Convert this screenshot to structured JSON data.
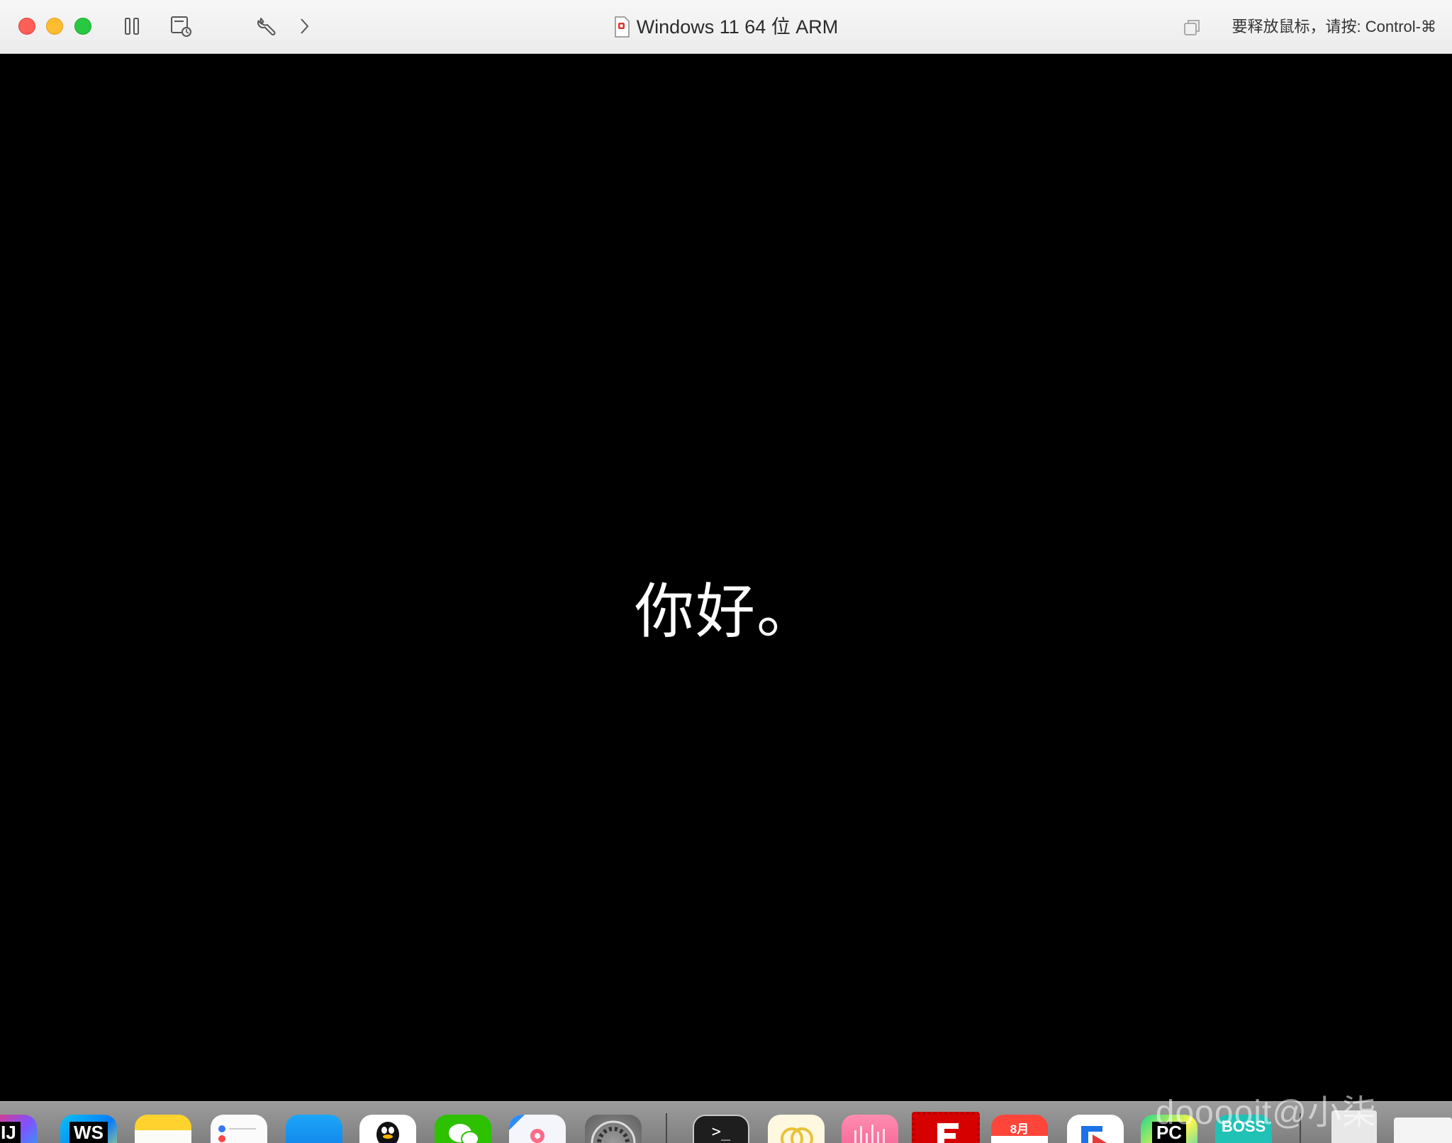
{
  "window": {
    "title": "Windows 11 64 位 ARM",
    "release_hint": "要释放鼠标，请按: Control-⌘"
  },
  "toolbar": {
    "buttons": [
      {
        "name": "pause-icon"
      },
      {
        "name": "snapshot-icon"
      },
      {
        "name": "wrench-icon"
      },
      {
        "name": "chevron-right-icon"
      }
    ]
  },
  "screen": {
    "greeting": "你好。"
  },
  "dock": {
    "apps": [
      {
        "name": "intellij-idea",
        "label": "IJ"
      },
      {
        "name": "webstorm",
        "label": "WS"
      },
      {
        "name": "notes",
        "label": ""
      },
      {
        "name": "reminders",
        "label": ""
      },
      {
        "name": "xcode",
        "label": ""
      },
      {
        "name": "qq",
        "label": ""
      },
      {
        "name": "wechat",
        "label": ""
      },
      {
        "name": "app-2024",
        "label": ""
      },
      {
        "name": "system-settings",
        "label": ""
      },
      {
        "name": "terminal",
        "label": ">_"
      },
      {
        "name": "app-yellow",
        "label": ""
      },
      {
        "name": "app-pink",
        "label": ""
      },
      {
        "name": "app-red-f",
        "label": ""
      },
      {
        "name": "calendar",
        "label": "8月"
      },
      {
        "name": "app-blue",
        "label": ""
      },
      {
        "name": "pycharm",
        "label": "PC"
      },
      {
        "name": "boss",
        "label": "BOSS"
      }
    ]
  },
  "watermark": "dooooit@小柒",
  "colors": {
    "close": "#fe5f57",
    "minimize": "#febc2e",
    "maximize": "#28c840"
  }
}
